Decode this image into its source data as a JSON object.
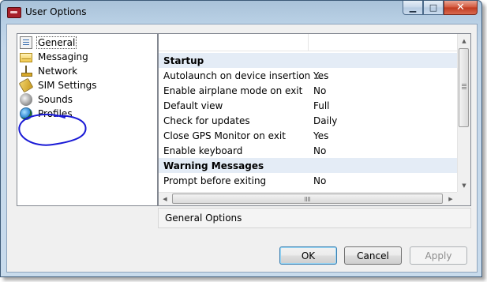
{
  "window": {
    "title": "User Options",
    "caption_buttons": {
      "minimize": "▁",
      "maximize": "□",
      "close": "✕"
    }
  },
  "tree": {
    "items": [
      {
        "label": "General",
        "icon": "general-icon",
        "selected": true
      },
      {
        "label": "Messaging",
        "icon": "envelope-icon"
      },
      {
        "label": "Network",
        "icon": "antenna-icon"
      },
      {
        "label": "SIM Settings",
        "icon": "sim-card-icon"
      },
      {
        "label": "Sounds",
        "icon": "speaker-icon"
      },
      {
        "label": "Profiles",
        "icon": "globe-icon"
      }
    ]
  },
  "grid": {
    "rows": [
      {
        "type": "category",
        "name": "Startup"
      },
      {
        "name": "Autolaunch on device insertion ...",
        "value": "Yes"
      },
      {
        "name": "Enable airplane mode on exit",
        "value": "No"
      },
      {
        "name": "Default view",
        "value": "Full"
      },
      {
        "name": "Check for updates",
        "value": "Daily"
      },
      {
        "name": "Close GPS Monitor on exit",
        "value": "Yes"
      },
      {
        "name": "Enable keyboard",
        "value": "No"
      },
      {
        "type": "category",
        "name": "Warning Messages"
      },
      {
        "name": "Prompt before exiting",
        "value": "No"
      }
    ]
  },
  "description": "General Options",
  "buttons": {
    "ok": "OK",
    "cancel": "Cancel",
    "apply": "Apply"
  },
  "colors": {
    "category_row": "#e4ecf6",
    "annotation_ink": "#1a1ad6",
    "close_button": "#c0391f"
  }
}
